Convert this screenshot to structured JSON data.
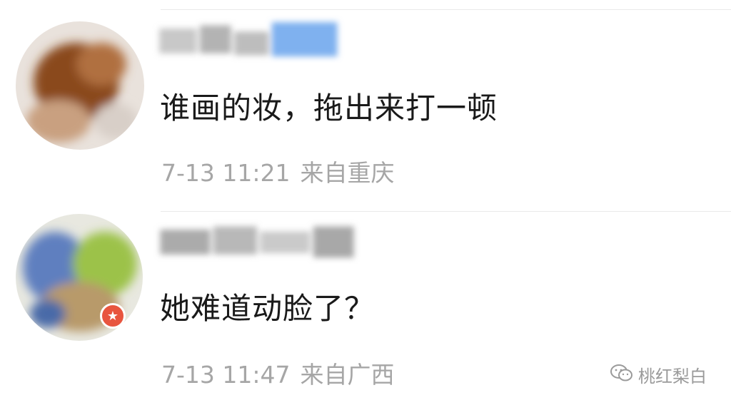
{
  "comments": [
    {
      "text": "谁画的妆，拖出来打一顿",
      "date": "7-13 11:21",
      "location": "来自重庆",
      "avatar_colors": [
        "#8a4a1f",
        "#b07040",
        "#c9a080"
      ],
      "name_blur_colors": [
        "#bdbdbd",
        "#7fb1ef"
      ]
    },
    {
      "text": "她难道动脸了？",
      "date": "7-13 11:47",
      "location": "来自广西",
      "avatar_colors": [
        "#5f7fbf",
        "#9cc24a",
        "#b89a6a"
      ],
      "name_blur_colors": [
        "#a8a8a8",
        "#c9c9c9"
      ],
      "badge_icon": "star-icon"
    }
  ],
  "watermark": {
    "text": "桃红梨白",
    "icon": "wechat-icon"
  },
  "colors": {
    "text": "#1a1a1a",
    "meta": "#a6a6a6",
    "badge": "#e8553f"
  }
}
